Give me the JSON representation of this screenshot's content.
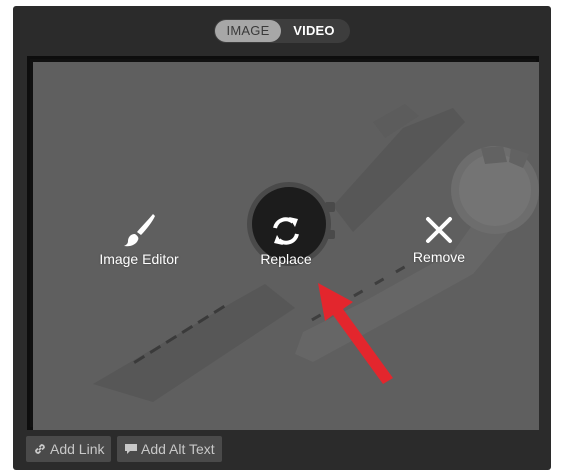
{
  "toggle": {
    "image_label": "IMAGE",
    "video_label": "VIDEO",
    "selected": "IMAGE"
  },
  "actions": {
    "image_editor": {
      "label": "Image Editor",
      "icon": "paintbrush-icon"
    },
    "replace": {
      "label": "Replace",
      "icon": "refresh-icon"
    },
    "remove": {
      "label": "Remove",
      "icon": "close-icon"
    }
  },
  "footer": {
    "add_link": {
      "label": "Add Link",
      "icon": "link-icon"
    },
    "add_alt_text": {
      "label": "Add Alt Text",
      "icon": "comment-icon"
    }
  },
  "colors": {
    "panel": "#2b2b2b",
    "overlay": "#5f5f5f",
    "annotation_arrow": "#e3262d"
  }
}
